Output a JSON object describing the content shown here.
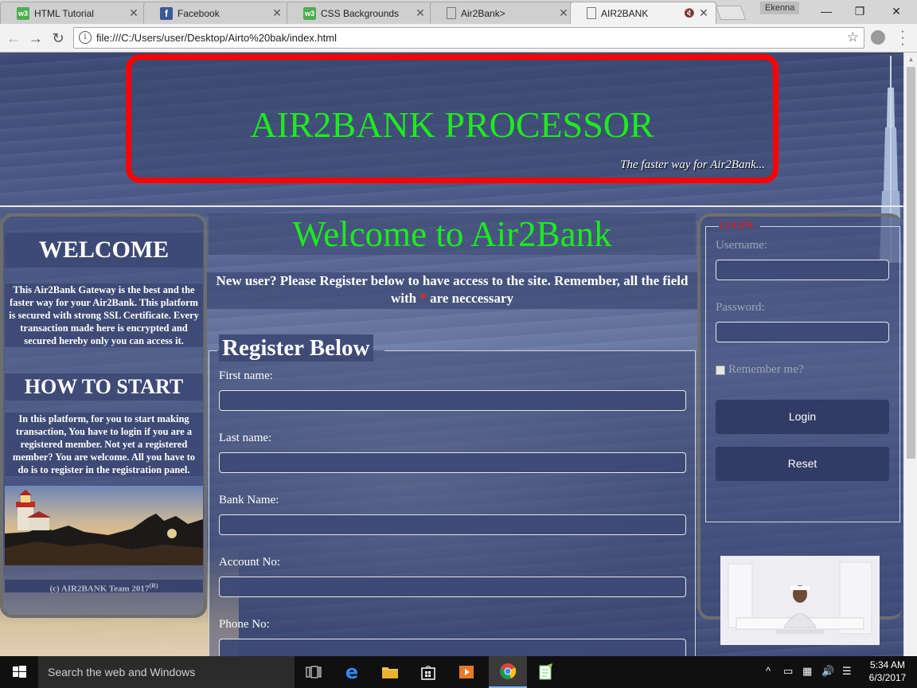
{
  "browser": {
    "tabs": [
      {
        "title": "HTML Tutorial",
        "icon": "w3schools-icon",
        "active": false
      },
      {
        "title": "Facebook",
        "icon": "facebook-icon",
        "active": false
      },
      {
        "title": "CSS Backgrounds",
        "icon": "w3schools-icon",
        "active": false
      },
      {
        "title": "Air2Bank>",
        "icon": "document-icon",
        "active": false
      },
      {
        "title": "AIR2BANK",
        "icon": "document-icon",
        "active": true
      }
    ],
    "profile_name": "Ekenna",
    "url": "file:///C:/Users/user/Desktop/Airto%20bak/index.html"
  },
  "header": {
    "title": "AIR2BANK PROCESSOR",
    "tagline": "The faster way for Air2Bank..."
  },
  "left_panel": {
    "welcome_heading": "WELCOME",
    "welcome_text": "This Air2Bank Gateway is the best and the faster way for your Air2Bank. This platform is secured with strong SSL Certificate. Every transaction made here is encrypted and secured hereby only you can access it.",
    "howto_heading": "HOW TO START",
    "howto_text": "In this platform, for you to start making transaction, You have to login if you are a registered member. Not yet a registered member? You are welcome. All you have to do is to register in the registration panel.",
    "footer": "(c) AIR2BANK Team 2017",
    "footer_sup": "(R)"
  },
  "main": {
    "welcome_title": "Welcome to Air2Bank",
    "notice_before": "New user? Please Register below to have access to the site. Remember, all the field with ",
    "notice_required_mark": "*",
    "notice_after": " are neccessary",
    "register_legend": "Register Below",
    "fields": {
      "first_name": "First name:",
      "last_name": "Last name:",
      "bank_name": "Bank Name:",
      "account_no": "Account No:",
      "phone_no": "Phone No:"
    }
  },
  "login": {
    "legend": "LOGIN",
    "username_label": "Username:",
    "password_label": "Password:",
    "remember_label": "Remember me?",
    "login_button": "Login",
    "reset_button": "Reset"
  },
  "taskbar": {
    "search_placeholder": "Search the web and Windows",
    "time": "5:34 AM",
    "date": "6/3/2017"
  },
  "colors": {
    "title_green": "#1eea1e",
    "header_border_red": "#ff0000",
    "required_red": "#ff2020",
    "login_legend_red": "#ff1010"
  }
}
